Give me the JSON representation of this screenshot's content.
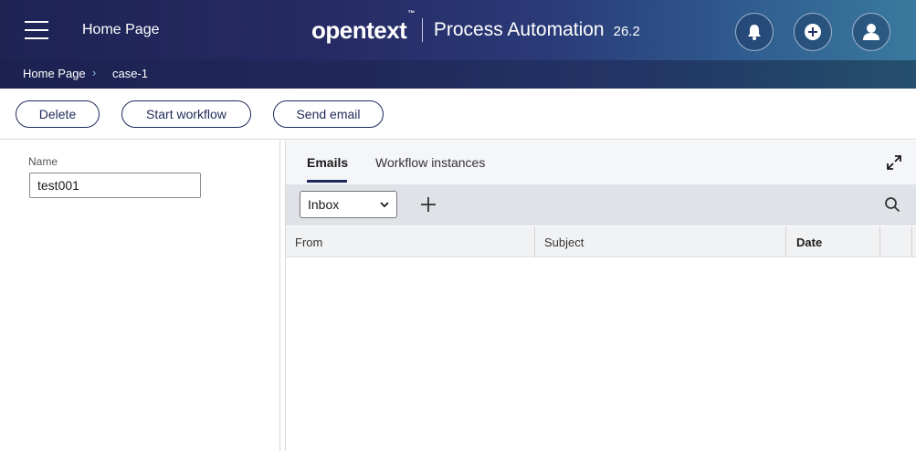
{
  "header": {
    "home_label": "Home Page",
    "brand_logo": "opentext",
    "brand_tm": "™",
    "product": "Process Automation",
    "version": "26.2",
    "icons": [
      "menu-icon",
      "bell-icon",
      "add-circle-icon",
      "user-icon"
    ]
  },
  "breadcrumb": {
    "items": [
      "Home Page",
      "case-1"
    ],
    "separator": "›"
  },
  "toolbar": {
    "delete_label": "Delete",
    "start_workflow_label": "Start workflow",
    "send_email_label": "Send email"
  },
  "form": {
    "name_label": "Name",
    "name_value": "test001"
  },
  "tabs": {
    "emails": "Emails",
    "workflow_instances": "Workflow instances",
    "active": "Emails"
  },
  "email_toolbar": {
    "folder_selected": "Inbox",
    "icons": [
      "plus-icon",
      "search-icon",
      "expand-icon"
    ]
  },
  "grid": {
    "columns": [
      "From",
      "Subject",
      "Date"
    ],
    "sorted_column": "Date",
    "rows": []
  },
  "colors": {
    "header_start": "#1e2354",
    "header_end": "#3a7a9e",
    "accent": "#1f2a5a",
    "grid_toolbar": "#dfe3e8"
  }
}
